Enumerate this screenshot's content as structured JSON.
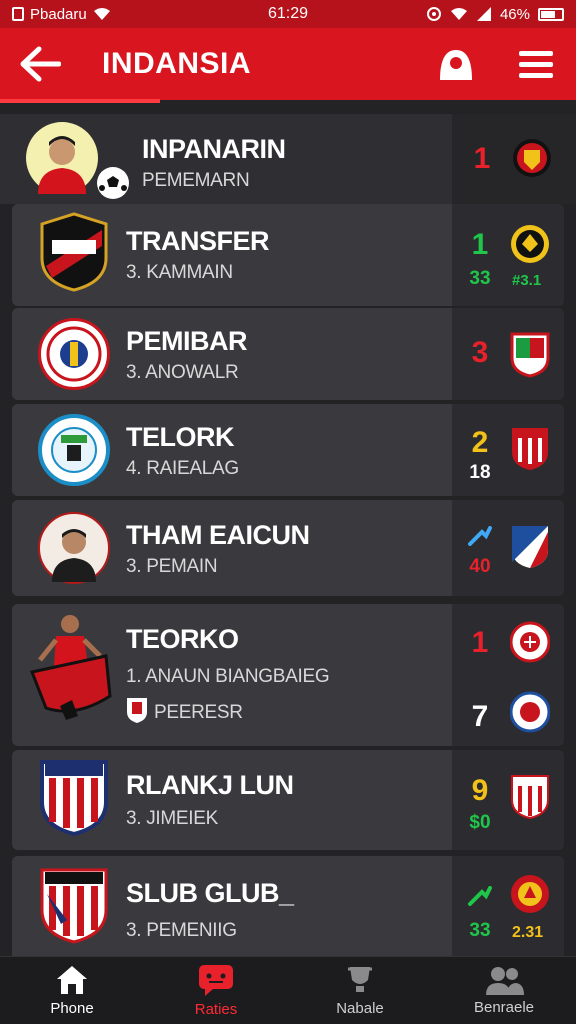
{
  "status_bar": {
    "carrier": "Pbadaru",
    "time": "61:29",
    "battery": "46%"
  },
  "header": {
    "title": "INDANSIA"
  },
  "colors": {
    "accent": "#d9151f",
    "red_num": "#e8212b",
    "green_num": "#1fc64a",
    "yellow_num": "#f3c21a",
    "white_num": "#ffffff"
  },
  "rows": [
    {
      "name": "INPANARIN",
      "sub": "PEMEMARN",
      "icon": "player-avatar-icon",
      "right": [
        {
          "num": "1",
          "color": "red",
          "crest": "red-yellow-crest-icon"
        }
      ]
    },
    {
      "name": "TRANSFER",
      "sub": "3. KAMMAIN",
      "icon": "shield-crest-icon",
      "right": [
        {
          "num": "1",
          "color": "green",
          "sub": "33",
          "crest": "yellow-black-crest-icon",
          "crest_label": "#3.1"
        }
      ]
    },
    {
      "name": "PEMIBAR",
      "sub": "3. ANOWALR",
      "icon": "round-crest-icon",
      "right": [
        {
          "num": "3",
          "color": "red",
          "crest": "green-red-crest-icon"
        }
      ]
    },
    {
      "name": "TELORK",
      "sub": "4. RAIEALAG",
      "icon": "blue-round-crest-icon",
      "right": [
        {
          "num": "2",
          "color": "yellow",
          "sub": "18",
          "crest": "red-white-crest-icon"
        }
      ]
    },
    {
      "name": "THAM EAICUN",
      "sub": "3. PEMAIN",
      "icon": "player-avatar-icon",
      "right": [
        {
          "num": "arrow",
          "color": "blue",
          "sub": "40",
          "crest": "blue-red-crest-icon"
        }
      ]
    },
    {
      "name": "TEORKO",
      "sub": "1. ANAUN BIANGBAIEG",
      "sub2": "PEERESR",
      "icon": "player-action-icon",
      "right": [
        {
          "num": "1",
          "color": "red",
          "crest": "red-round-crest-icon"
        },
        {
          "num": "7",
          "color": "white",
          "crest": "blue-round-crest-icon"
        }
      ]
    },
    {
      "name": "RLANKJ LUN",
      "sub": "3. JIMEIEK",
      "icon": "striped-crest-icon",
      "right": [
        {
          "num": "9",
          "color": "yellow",
          "sub": "$0",
          "crest": "striped-crest-icon"
        }
      ]
    },
    {
      "name": "SLUB GLUB_",
      "sub": "3. PEMENIIG",
      "icon": "striped-crest-icon",
      "right": [
        {
          "num": "arrow",
          "color": "green",
          "sub": "33",
          "crest": "red-yellow-round-crest-icon",
          "crest_label": "2.31"
        }
      ]
    }
  ],
  "bottom_nav": [
    {
      "label": "Phone",
      "icon": "home-icon",
      "active": false
    },
    {
      "label": "Raties",
      "icon": "message-icon",
      "active": true
    },
    {
      "label": "Nabale",
      "icon": "trophy-icon",
      "active": false
    },
    {
      "label": "Benraele",
      "icon": "people-icon",
      "active": false
    }
  ]
}
